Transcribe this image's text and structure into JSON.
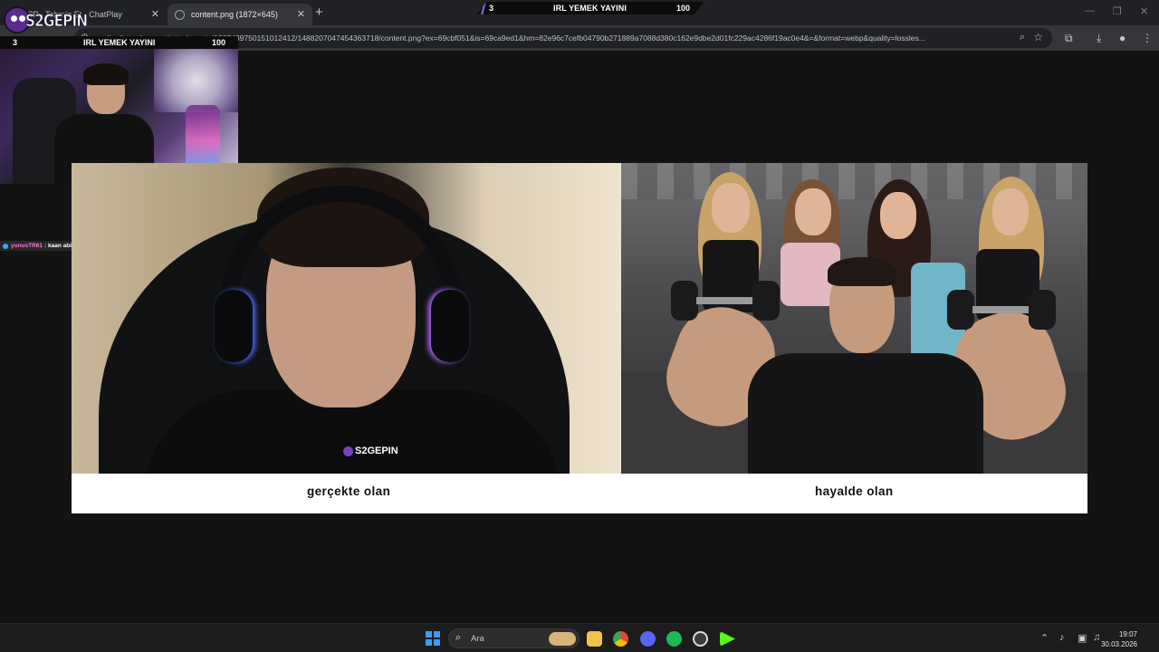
{
  "browser": {
    "tabs": [
      {
        "label": "CP - Tahmin Et - ChatPlay",
        "active": false
      },
      {
        "label": "content.png (1872×645)",
        "active": true
      }
    ],
    "url": "media.discordapp.net/attachments/1387439750151012412/1488207047454363718/content.png?ex=69cbf051&is=69ca9ed1&hm=82e96c7cefb04790b271889a7088d380c162e9dbe2d01fc229ac4286f19ac0e4&=&format=webp&quality=lossles..."
  },
  "stream": {
    "logo_text": "S2GEPIN",
    "title": "IRL YEMEK YAYINI",
    "left_number": "3",
    "right_number": "100",
    "chat": {
      "user": "yunusTR61",
      "message": ": kaan abi öze!"
    },
    "brand_color": "#7a3fc0"
  },
  "meme": {
    "left_caption": "gerçekte olan",
    "right_caption": "hayalde olan",
    "watermark": "S2GEPIN"
  },
  "taskbar": {
    "search_label": "Ara",
    "time": "19:07",
    "date": "30.03.2026",
    "icons": [
      "windows-start-icon",
      "file-explorer-icon",
      "chrome-icon",
      "discord-icon",
      "spotify-icon",
      "obs-icon",
      "kick-icon"
    ]
  }
}
